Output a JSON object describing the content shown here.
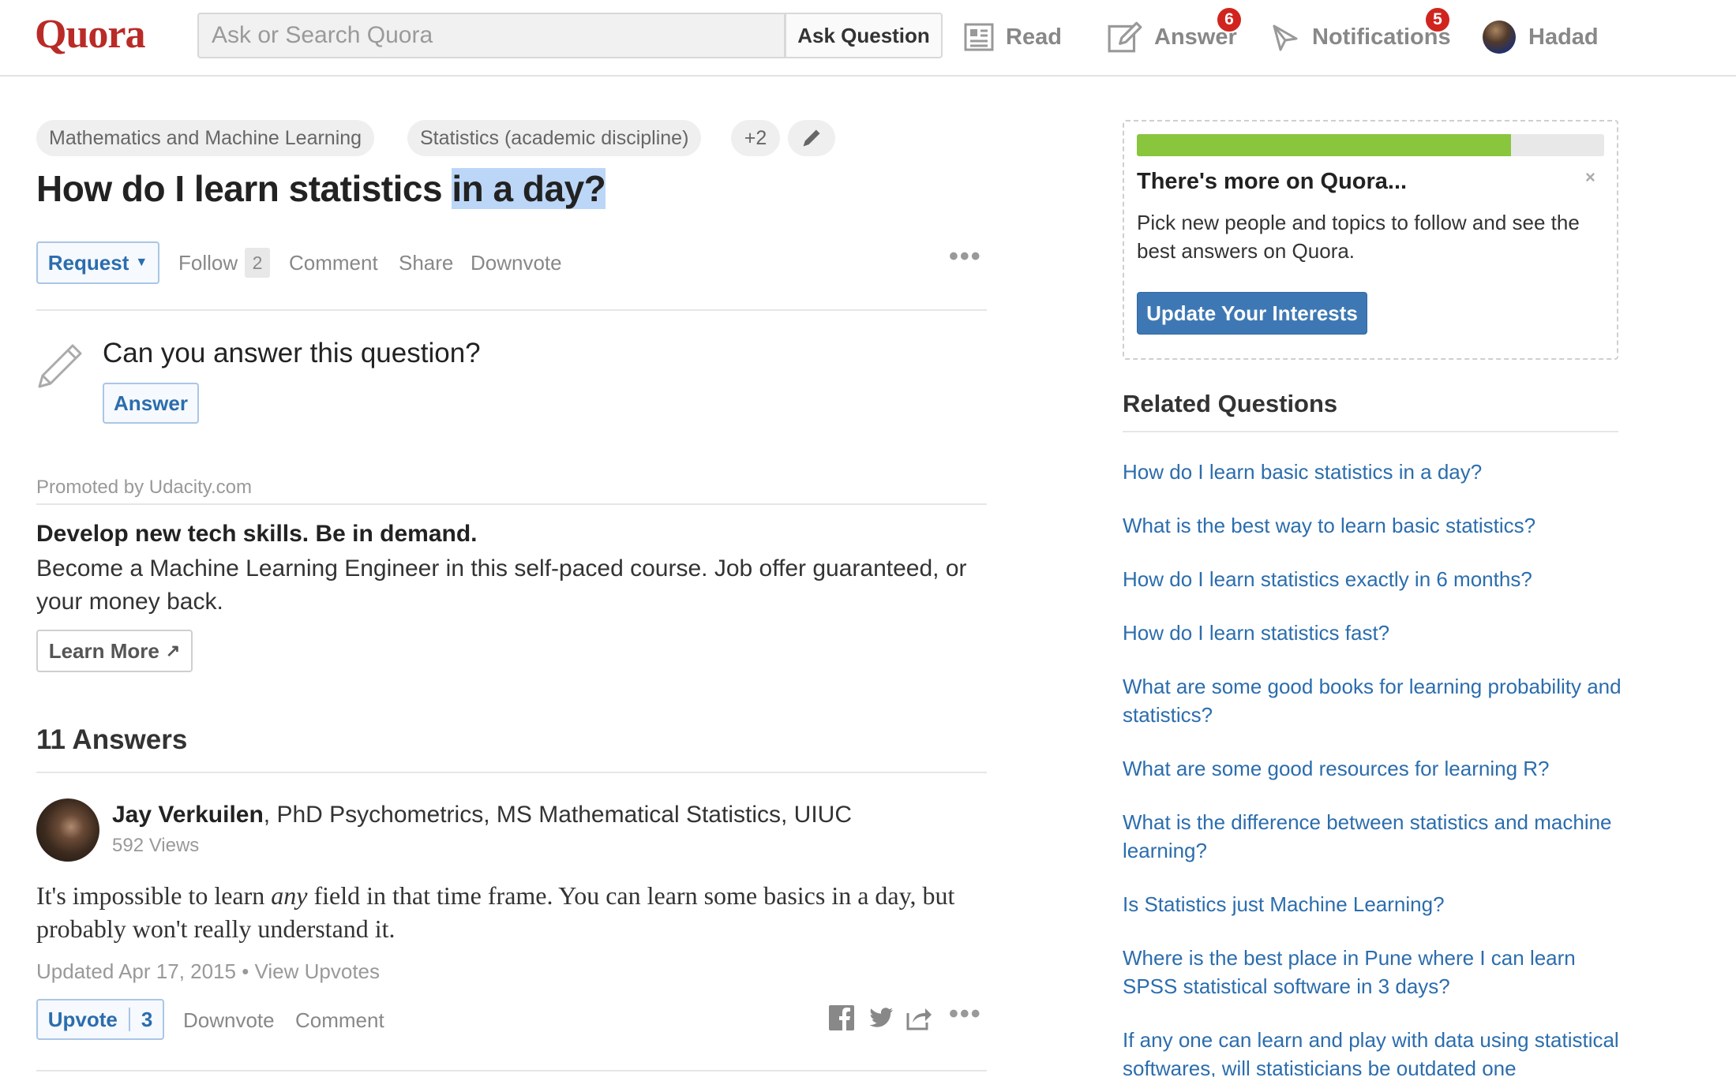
{
  "header": {
    "logo": "Quora",
    "search_placeholder": "Ask or Search Quora",
    "ask_button": "Ask Question",
    "nav": {
      "read": "Read",
      "answer": "Answer",
      "answer_badge": "6",
      "notifications": "Notifications",
      "notifications_badge": "5",
      "user": "Hadad"
    }
  },
  "question": {
    "topics": [
      "Mathematics and Machine Learning",
      "Statistics (academic discipline)",
      "+2"
    ],
    "title_plain": "How do I learn statistics ",
    "title_highlight": "in a day?",
    "actions": {
      "request": "Request",
      "follow": "Follow",
      "follow_count": "2",
      "comment": "Comment",
      "share": "Share",
      "downvote": "Downvote"
    },
    "prompt": "Can you answer this question?",
    "answer_button": "Answer"
  },
  "promotion": {
    "label": "Promoted by Udacity.com",
    "headline": "Develop new tech skills. Be in demand.",
    "body": "Become a Machine Learning Engineer in this self-paced course. Job offer guaranteed, or your money back.",
    "button": "Learn More"
  },
  "answers": {
    "count_label": "11 Answers",
    "first": {
      "author": "Jay Verkuilen",
      "credentials": ", PhD Psychometrics, MS Mathematical Statistics, UIUC",
      "views": "592 Views",
      "text_before": "It's impossible to learn ",
      "text_emph": "any",
      "text_after": " field in that time frame. You can learn some basics in a day, but probably won't really understand it.",
      "updated": "Updated Apr 17, 2015 • View Upvotes",
      "upvote": "Upvote",
      "upvote_count": "3",
      "downvote": "Downvote",
      "comment": "Comment"
    }
  },
  "sidebar": {
    "promo": {
      "progress_fraction": 0.8,
      "title": "There's more on Quora...",
      "close": "×",
      "text": "Pick new people and topics to follow and see the best answers on Quora.",
      "button": "Update Your Interests"
    },
    "related_title": "Related Questions",
    "related": [
      "How do I learn basic statistics in a day?",
      "What is the best way to learn basic statistics?",
      "How do I learn statistics exactly in 6 months?",
      "How do I learn statistics fast?",
      "What are some good books for learning probability and statistics?",
      "What are some good resources for learning R?",
      "What is the difference between statistics and machine learning?",
      "Is Statistics just Machine Learning?",
      "Where is the best place in Pune where I can learn SPSS statistical software in 3 days?",
      "If any one can learn and play with data using statistical softwares, will statisticians be outdated one"
    ]
  },
  "colors": {
    "brand": "#b92b27",
    "link": "#2b6dad",
    "badge": "#d0251e",
    "progress": "#8ac53e",
    "button_primary": "#3e78b4",
    "highlight": "#bcd6f7"
  }
}
